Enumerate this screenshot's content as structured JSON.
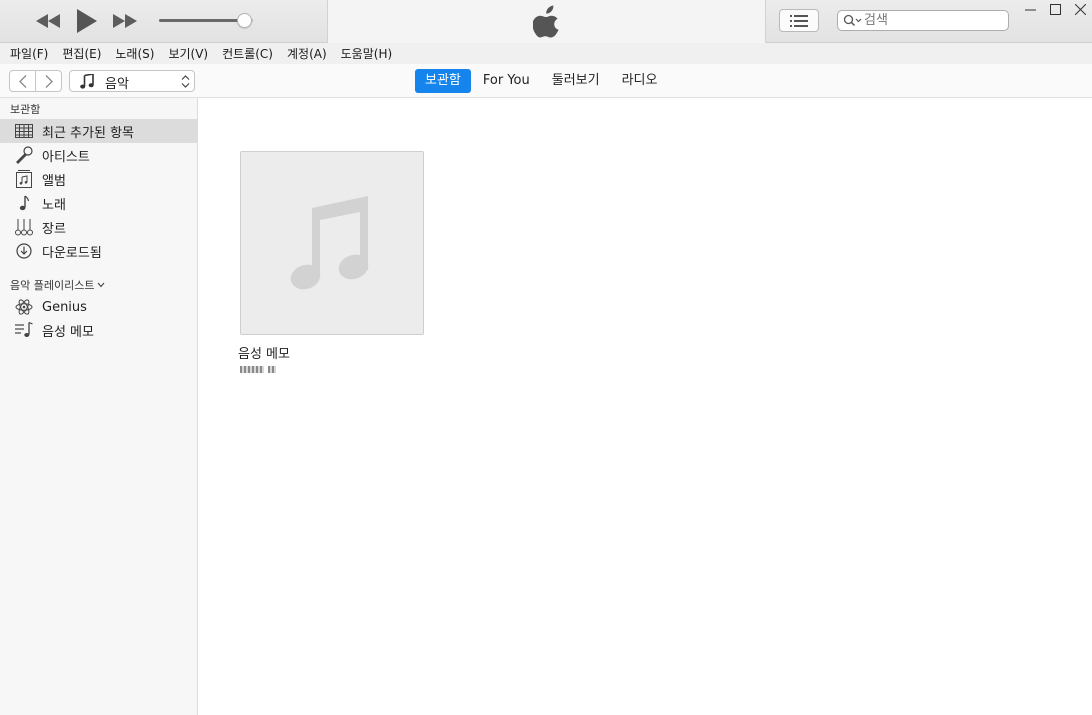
{
  "window": {
    "controls": {
      "minimize_icon": "minimize-icon",
      "maximize_icon": "maximize-icon",
      "close_icon": "close-icon"
    }
  },
  "player": {
    "rewind_icon": "rewind-icon",
    "play_icon": "play-icon",
    "forward_icon": "fast-forward-icon",
    "volume_level": 0.9,
    "logo_icon": "apple-logo-icon"
  },
  "toolbar": {
    "list_view_icon": "list-icon",
    "search": {
      "placeholder": "검색",
      "value": ""
    }
  },
  "menu": {
    "items": [
      "파일(F)",
      "편집(E)",
      "노래(S)",
      "보기(V)",
      "컨트롤(C)",
      "계정(A)",
      "도움말(H)"
    ]
  },
  "nav": {
    "back_icon": "chevron-left-icon",
    "forward_icon": "chevron-right-icon",
    "source": {
      "label": "음악",
      "icon": "music-note-icon"
    },
    "tabs": [
      {
        "label": "보관함",
        "active": true
      },
      {
        "label": "For You",
        "active": false
      },
      {
        "label": "둘러보기",
        "active": false
      },
      {
        "label": "라디오",
        "active": false
      }
    ]
  },
  "sidebar": {
    "library_title": "보관함",
    "library_items": [
      {
        "label": "최근 추가된 항목",
        "icon": "grid-icon",
        "selected": true
      },
      {
        "label": "아티스트",
        "icon": "microphone-icon",
        "selected": false
      },
      {
        "label": "앨범",
        "icon": "album-icon",
        "selected": false
      },
      {
        "label": "노래",
        "icon": "music-note-icon",
        "selected": false
      },
      {
        "label": "장르",
        "icon": "guitars-icon",
        "selected": false
      },
      {
        "label": "다운로드됨",
        "icon": "download-icon",
        "selected": false
      }
    ],
    "playlists_title": "음악 플레이리스트",
    "playlist_items": [
      {
        "label": "Genius",
        "icon": "genius-atom-icon"
      },
      {
        "label": "음성 메모",
        "icon": "playlist-icon"
      }
    ]
  },
  "main": {
    "albums": [
      {
        "title": "음성 메모",
        "artwork_icon": "music-note-icon"
      }
    ]
  },
  "colors": {
    "accent": "#1584ec",
    "titlebar": "#e6e6e6",
    "sidebar_bg": "#f7f7f7",
    "sidebar_selected": "#dcdcdc",
    "artwork_bg": "#ececec",
    "artwork_note": "#d2d2d2"
  }
}
